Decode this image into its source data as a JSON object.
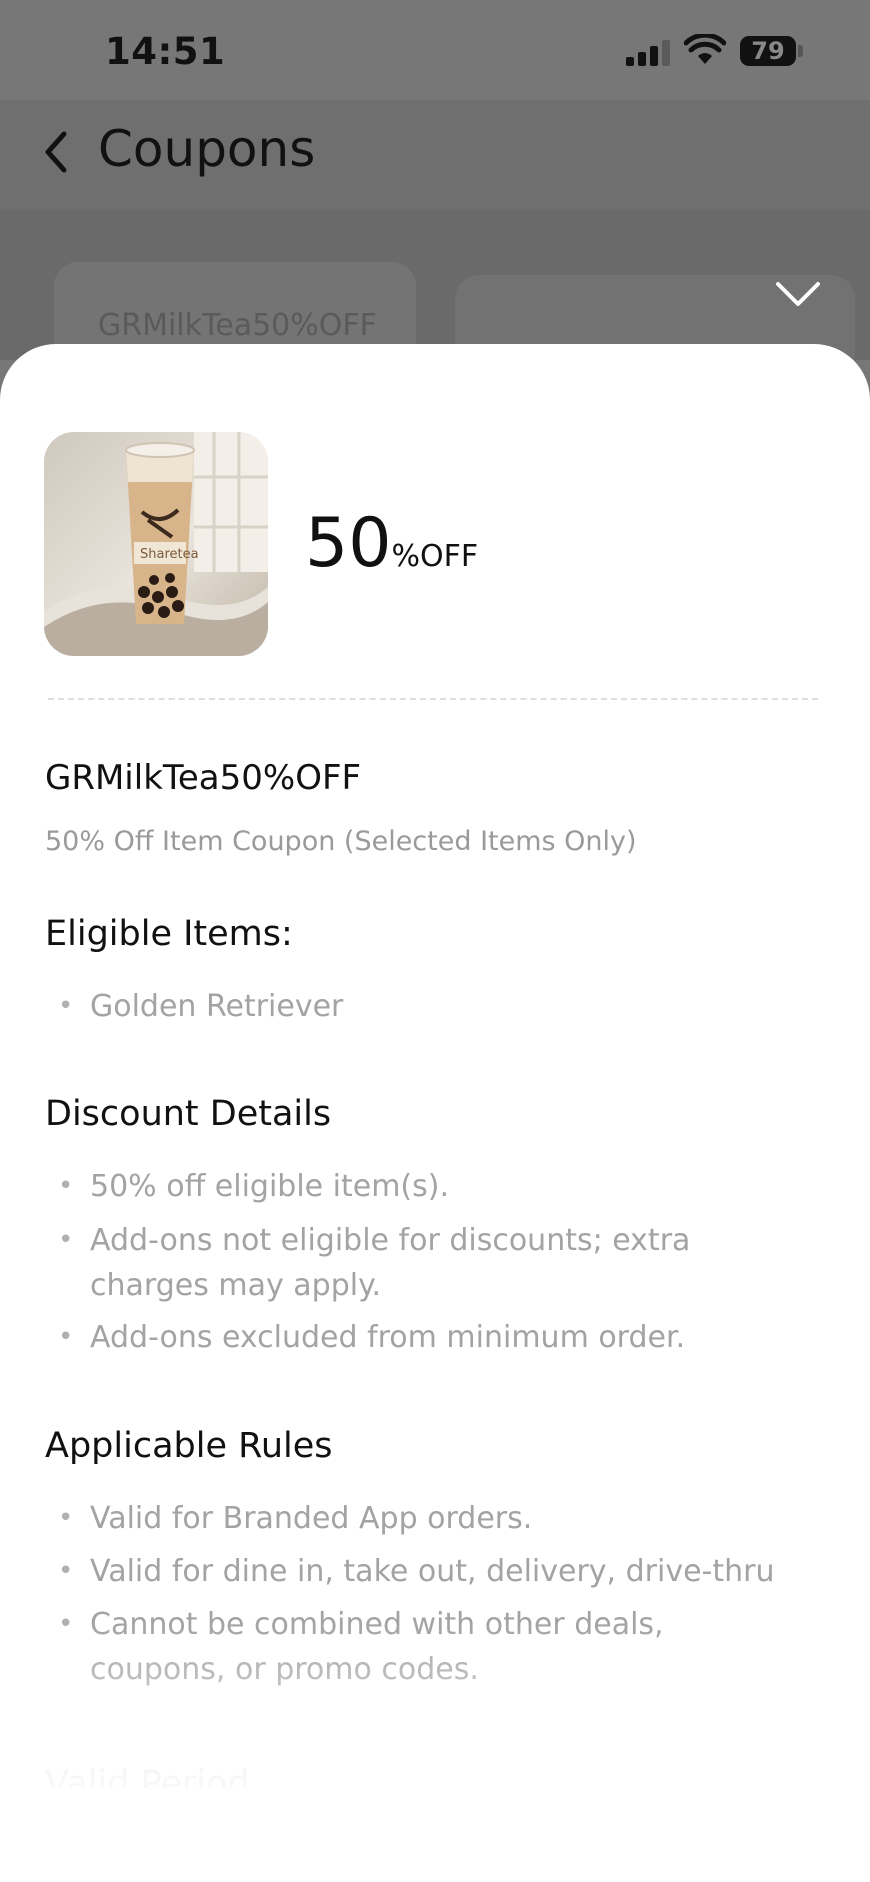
{
  "status_bar": {
    "time": "14:51",
    "battery": "79"
  },
  "nav": {
    "title": "Coupons"
  },
  "background_list": {
    "card_code": "GRMilkTea50%OFF"
  },
  "sheet": {
    "discount_value": "50",
    "discount_unit": "%OFF",
    "coupon_code": "GRMilkTea50%OFF",
    "coupon_description": "50% Off Item Coupon (Selected Items Only)",
    "eligible_items": {
      "heading": "Eligible Items:",
      "items": [
        "Golden Retriever"
      ]
    },
    "discount_details": {
      "heading": "Discount Details",
      "items": [
        "50% off eligible item(s).",
        "Add-ons not eligible for discounts; extra charges may apply.",
        "Add-ons excluded from minimum order."
      ]
    },
    "applicable_rules": {
      "heading": "Applicable Rules",
      "items": [
        "Valid for Branded App orders.",
        "Valid for dine in, take out, delivery, drive-thru",
        "Cannot be combined with other deals, coupons, or promo codes."
      ]
    },
    "valid_period_heading": "Valid Period"
  },
  "product_image": {
    "brand_text": "Sharetea"
  },
  "colors": {
    "overlay": "#777777",
    "sheet_bg": "#ffffff",
    "text_primary": "#111111",
    "text_secondary": "#a3a3a3"
  },
  "icons": {
    "back": "chevron-left-icon",
    "dismiss": "chevron-down-icon",
    "signal": "cellular-signal-icon",
    "wifi": "wifi-icon",
    "battery": "battery-icon"
  }
}
